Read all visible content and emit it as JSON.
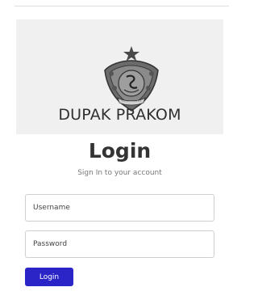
{
  "header": {
    "logo_icon": "regency-emblem-icon",
    "app_title": "DUPAK PRAKOM"
  },
  "login": {
    "heading": "Login",
    "subheading": "Sign In to your account",
    "username_placeholder": "Username",
    "password_placeholder": "Password",
    "button_label": "Login"
  },
  "colors": {
    "banner_bg": "#f0f0f0",
    "button_bg": "#2b25c7",
    "button_text": "#ffffff"
  }
}
